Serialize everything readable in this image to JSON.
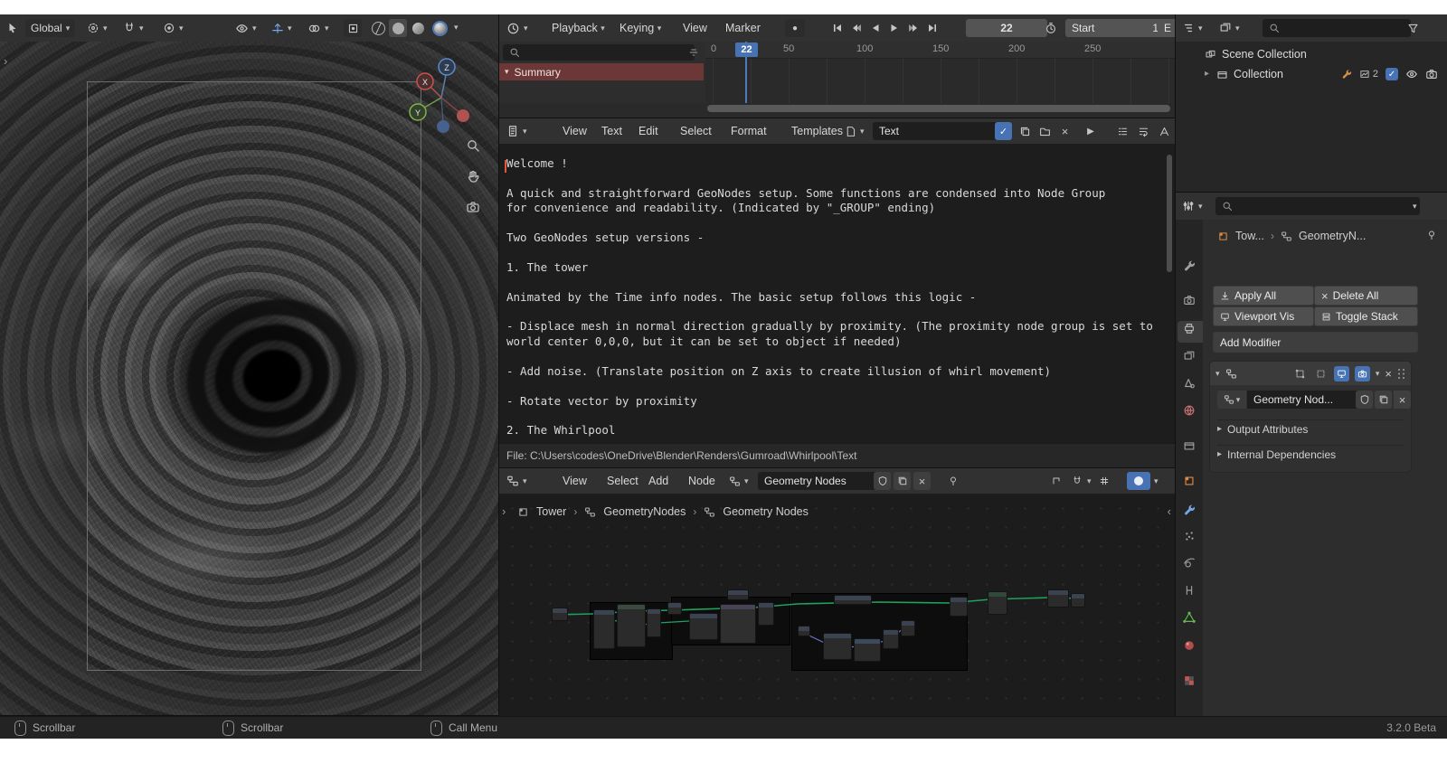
{
  "app": {
    "version": "3.2.0 Beta"
  },
  "icons": {
    "chevron_down": "▾",
    "chevron_right": "▸",
    "breadcrumb_sep": "›",
    "panel_arrow_left": "‹",
    "panel_arrow_right": "›",
    "close": "×",
    "check": "✓",
    "run": "▶",
    "record": "●"
  },
  "viewport": {
    "orientation": "Global",
    "axis_x": "X",
    "axis_y": "Y",
    "axis_z": "Z"
  },
  "timeline": {
    "menus": [
      "Playback",
      "Keying",
      "View",
      "Marker"
    ],
    "frame_field": "22",
    "playhead_label": "22",
    "start_label": "Start",
    "start_value": "1",
    "end_label": "E",
    "channel": "Summary",
    "ruler": [
      "0",
      "50",
      "100",
      "150",
      "200",
      "250"
    ]
  },
  "text_editor": {
    "menus": [
      "View",
      "Text",
      "Edit",
      "Select",
      "Format",
      "Templates"
    ],
    "datablock": "Text",
    "content": "Welcome !\n\nA quick and straightforward GeoNodes setup. Some functions are condensed into Node Group\nfor convenience and readability. (Indicated by \"_GROUP\" ending)\n\nTwo GeoNodes setup versions -\n\n1. The tower\n\nAnimated by the Time info nodes. The basic setup follows this logic -\n\n- Displace mesh in normal direction gradually by proximity. (The proximity node group is set to\nworld center 0,0,0, but it can be set to object if needed)\n\n- Add noise. (Translate position on Z axis to create illusion of whirl movement)\n\n- Rotate vector by proximity\n\n2. The Whirlpool",
    "footer_path": "File: C:\\Users\\codes\\OneDrive\\Blender\\Renders\\Gumroad\\Whirlpool\\Text"
  },
  "node_editor": {
    "menus": [
      "View",
      "Select",
      "Add",
      "Node"
    ],
    "datablock": "Geometry Nodes",
    "breadcrumb": [
      "Tower",
      "GeometryNodes",
      "Geometry Nodes"
    ]
  },
  "outliner": {
    "scene_collection": "Scene Collection",
    "collection": "Collection",
    "collection_badge": "2"
  },
  "properties": {
    "path": [
      "Tow...",
      "GeometryN..."
    ],
    "buttons": {
      "apply_all": "Apply All",
      "delete_all": "Delete All",
      "viewport_vis": "Viewport Vis",
      "toggle_stack": "Toggle Stack"
    },
    "add_modifier": "Add Modifier",
    "modifier_name": "Geometry Nod...",
    "sections": [
      "Output Attributes",
      "Internal Dependencies"
    ]
  },
  "status": {
    "hints": [
      "Scrollbar",
      "Scrollbar",
      "Call Menu"
    ],
    "version": "3.2.0 Beta"
  }
}
